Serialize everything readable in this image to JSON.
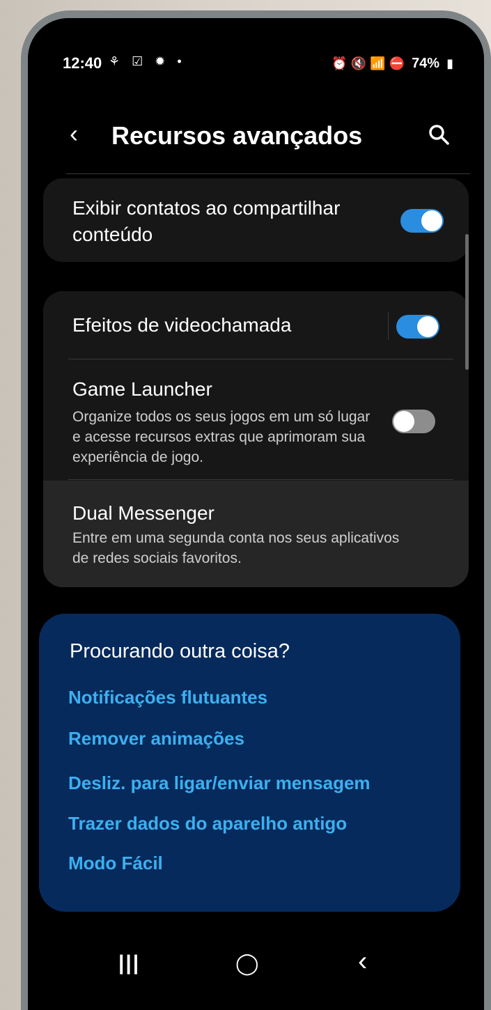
{
  "status_bar": {
    "time": "12:40",
    "left_icons": "⚘ ☑ ✹ •",
    "right_icons": "⏰ 🔇 📶 ⛔",
    "battery": "74%"
  },
  "header": {
    "title": "Recursos avançados",
    "back_icon": "‹",
    "search_icon": "search-icon"
  },
  "settings": {
    "item1": {
      "title": "Exibir contatos ao compartilhar conteúdo",
      "toggle": true
    },
    "item2": {
      "title": "Efeitos de videochamada",
      "toggle": true
    },
    "item3": {
      "title": "Game Launcher",
      "description": "Organize todos os seus jogos em um só lugar e acesse recursos extras que aprimoram sua experiência de jogo.",
      "toggle": false
    },
    "item4": {
      "title": "Dual Messenger",
      "description": "Entre em uma segunda conta nos seus aplicativos de redes sociais favoritos."
    }
  },
  "suggestions": {
    "title": "Procurando outra coisa?",
    "links": [
      "Notificações flutuantes",
      "Remover animações",
      "Desliz. para ligar/enviar mensagem",
      "Trazer dados do aparelho antigo",
      "Modo Fácil"
    ]
  },
  "nav": {
    "recent": "|||",
    "home": "◯",
    "back": "‹"
  },
  "colors": {
    "accent": "#2a8de0",
    "link": "#3cb0f0",
    "suggest_bg": "#062a5c"
  }
}
